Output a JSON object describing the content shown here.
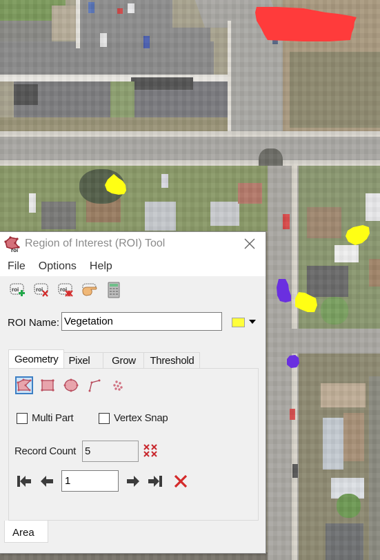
{
  "window": {
    "title": "Region of Interest (ROI) Tool",
    "icon": "roi-tool-icon",
    "close_icon": "close-icon"
  },
  "menu": {
    "items": [
      {
        "label": "File"
      },
      {
        "label": "Options"
      },
      {
        "label": "Help"
      }
    ]
  },
  "toolbar": {
    "buttons": [
      {
        "name": "new-roi-button",
        "icon": "roi-add-icon"
      },
      {
        "name": "delete-roi-button",
        "icon": "roi-delete-icon"
      },
      {
        "name": "delete-all-roi-button",
        "icon": "roi-delete-all-icon"
      },
      {
        "name": "goto-roi-button",
        "icon": "pointing-hand-icon"
      },
      {
        "name": "statistics-button",
        "icon": "calculator-icon"
      }
    ]
  },
  "roi": {
    "name_label": "ROI Name:",
    "name_value": "Vegetation",
    "color": "#ffff3c"
  },
  "tabs": {
    "items": [
      {
        "label": "Geometry",
        "active": true
      },
      {
        "label": "Pixel",
        "active": false
      },
      {
        "label": "Grow",
        "active": false
      },
      {
        "label": "Threshold",
        "active": false
      }
    ]
  },
  "geometry": {
    "tools": [
      {
        "name": "polygon-tool",
        "icon": "polygon-icon",
        "selected": true
      },
      {
        "name": "rectangle-tool",
        "icon": "rectangle-icon",
        "selected": false
      },
      {
        "name": "ellipse-tool",
        "icon": "ellipse-icon",
        "selected": false
      },
      {
        "name": "polyline-tool",
        "icon": "polyline-icon",
        "selected": false
      },
      {
        "name": "point-tool",
        "icon": "points-icon",
        "selected": false
      }
    ],
    "multi_part_label": "Multi Part",
    "multi_part_checked": false,
    "vertex_snap_label": "Vertex Snap",
    "vertex_snap_checked": false,
    "record_count_label": "Record Count",
    "record_count_value": "5",
    "current_record": "1"
  },
  "bottom_tabs": {
    "items": [
      {
        "label": "Area",
        "active": true
      }
    ]
  },
  "map": {
    "roi_colors": {
      "red": "#ff3b3b",
      "yellow": "#ffff14",
      "purple": "#6a2fe0"
    }
  }
}
